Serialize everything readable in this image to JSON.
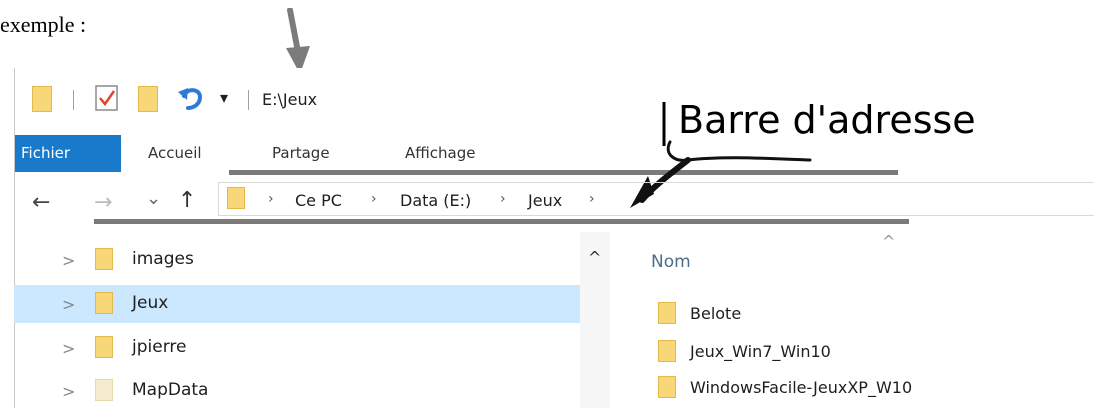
{
  "intro_text": "exemple :",
  "annotation_label": "Barre d'adresse",
  "window": {
    "title_path": "E:\\Jeux",
    "qat_dropdown_glyph": "▾",
    "ribbon_tabs": [
      "Fichier",
      "Accueil",
      "Partage",
      "Affichage"
    ],
    "address": {
      "nav_back": "←",
      "nav_forward": "→",
      "nav_recent": "⌄",
      "nav_up": "↑",
      "segments": [
        "Ce PC",
        "Data (E:)",
        "Jeux"
      ],
      "separator": "›"
    },
    "nav_pane": {
      "expander": ">",
      "scroll_up": "^",
      "items": [
        {
          "label": "images",
          "selected": false
        },
        {
          "label": "Jeux",
          "selected": true
        },
        {
          "label": "jpierre",
          "selected": false
        },
        {
          "label": "MapData",
          "selected": false
        }
      ]
    },
    "file_list": {
      "column_header": "Nom",
      "sort_glyph": "^",
      "items": [
        "Belote",
        "Jeux_Win7_Win10",
        "WindowsFacile-JeuxXP_W10"
      ]
    }
  },
  "colors": {
    "file_tab": "#1979ca",
    "selection": "#cce8ff",
    "folder": "#f7d777",
    "folder_pale": "#f5eccd",
    "bars": "#7a7a7a",
    "undo_icon": "#2e7bd6"
  },
  "icons": [
    "folder-icon",
    "properties-icon",
    "undo-icon",
    "qat-dropdown-icon",
    "back-arrow-icon",
    "forward-arrow-icon",
    "recent-chevron-icon",
    "up-arrow-icon",
    "address-folder-icon",
    "scroll-up-icon",
    "sort-indicator-icon",
    "pointer-arrow-icon",
    "annotation-arrow-icon"
  ]
}
